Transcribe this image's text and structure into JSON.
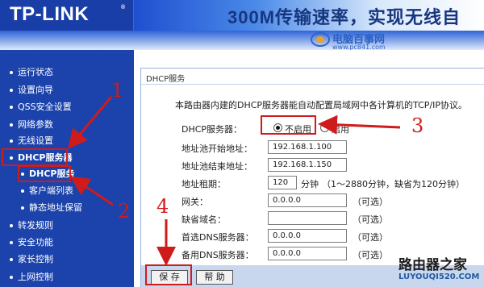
{
  "banner": {
    "logo_text": "TP-LINK",
    "logo_reg": "®",
    "slogan": "300M传输速率，实现无线自",
    "watermark_site": "电脑百事网",
    "watermark_url": "www.pc841.com"
  },
  "sidebar": {
    "items": [
      {
        "label": "运行状态"
      },
      {
        "label": "设置向导"
      },
      {
        "label": "QSS安全设置"
      },
      {
        "label": "网络参数"
      },
      {
        "label": "无线设置"
      },
      {
        "label": "DHCP服务器"
      },
      {
        "label": "DHCP服务"
      },
      {
        "label": "客户端列表"
      },
      {
        "label": "静态地址保留"
      },
      {
        "label": "转发规则"
      },
      {
        "label": "安全功能"
      },
      {
        "label": "家长控制"
      },
      {
        "label": "上网控制"
      }
    ]
  },
  "panel": {
    "title": "DHCP服务",
    "intro": "本路由器内建的DHCP服务器能自动配置局域网中各计算机的TCP/IP协议。",
    "dhcp_server_label": "DHCP服务器：",
    "radio_disable": "不启用",
    "radio_enable": "启用",
    "radio_selected": "不启用",
    "start_label": "地址池开始地址：",
    "start_value": "192.168.1.100",
    "end_label": "地址池结束地址：",
    "end_value": "192.168.1.150",
    "lease_label": "地址租期：",
    "lease_value": "120",
    "lease_unit": "分钟",
    "lease_hint": "（1～2880分钟，缺省为120分钟）",
    "gateway_label": "网关：",
    "gateway_value": "0.0.0.0",
    "gateway_hint": "（可选）",
    "domain_label": "缺省域名：",
    "domain_value": "",
    "domain_hint": "（可选）",
    "dns1_label": "首选DNS服务器：",
    "dns1_value": "0.0.0.0",
    "dns1_hint": "（可选）",
    "dns2_label": "备用DNS服务器：",
    "dns2_value": "0.0.0.0",
    "dns2_hint": "（可选）",
    "save_button": "保 存",
    "help_button": "帮 助"
  },
  "annotations": {
    "n1": "1",
    "n2": "2",
    "n3": "3",
    "n4": "4",
    "color": "#d01b1b"
  },
  "watermark": {
    "title": "路由器之家",
    "url": "LUYOUQI520.COM"
  },
  "colors": {
    "sidebar_bg": "#1b43ab",
    "banner_bg": "#1d47b4",
    "bottom_bar": "#c8d6ee"
  }
}
